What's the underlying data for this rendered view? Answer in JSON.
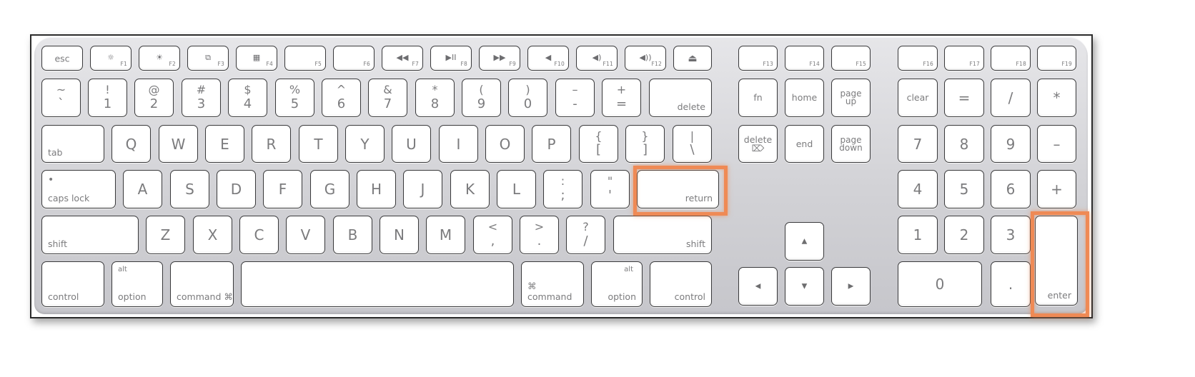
{
  "keyboard": {
    "highlight_color": "#ef8a55",
    "highlighted_keys": [
      "return",
      "enter"
    ],
    "function_row": [
      {
        "id": "esc",
        "label": "esc"
      },
      {
        "id": "f1",
        "icon": "brightness-down-icon",
        "glyph": "☼",
        "num": "F1"
      },
      {
        "id": "f2",
        "icon": "brightness-up-icon",
        "glyph": "☀",
        "num": "F2"
      },
      {
        "id": "f3",
        "icon": "expose-icon",
        "glyph": "⧉",
        "num": "F3"
      },
      {
        "id": "f4",
        "icon": "dashboard-icon",
        "glyph": "▦",
        "num": "F4"
      },
      {
        "id": "f5",
        "num": "F5"
      },
      {
        "id": "f6",
        "num": "F6"
      },
      {
        "id": "f7",
        "icon": "rewind-icon",
        "glyph": "◀◀",
        "num": "F7"
      },
      {
        "id": "f8",
        "icon": "play-pause-icon",
        "glyph": "▶II",
        "num": "F8"
      },
      {
        "id": "f9",
        "icon": "fast-forward-icon",
        "glyph": "▶▶",
        "num": "F9"
      },
      {
        "id": "f10",
        "icon": "mute-icon",
        "glyph": "◀",
        "num": "F10"
      },
      {
        "id": "f11",
        "icon": "volume-down-icon",
        "glyph": "◀)",
        "num": "F11"
      },
      {
        "id": "f12",
        "icon": "volume-up-icon",
        "glyph": "◀))",
        "num": "F12"
      },
      {
        "id": "eject",
        "icon": "eject-icon",
        "glyph": "⏏"
      },
      {
        "id": "f13",
        "num": "F13"
      },
      {
        "id": "f14",
        "num": "F14"
      },
      {
        "id": "f15",
        "num": "F15"
      },
      {
        "id": "f16",
        "num": "F16"
      },
      {
        "id": "f17",
        "num": "F17"
      },
      {
        "id": "f18",
        "num": "F18"
      },
      {
        "id": "f19",
        "num": "F19"
      }
    ],
    "number_row": [
      {
        "id": "backtick",
        "shift": "~",
        "base": "`"
      },
      {
        "id": "1",
        "shift": "!",
        "base": "1"
      },
      {
        "id": "2",
        "shift": "@",
        "base": "2"
      },
      {
        "id": "3",
        "shift": "#",
        "base": "3"
      },
      {
        "id": "4",
        "shift": "$",
        "base": "4"
      },
      {
        "id": "5",
        "shift": "%",
        "base": "5"
      },
      {
        "id": "6",
        "shift": "^",
        "base": "6"
      },
      {
        "id": "7",
        "shift": "&",
        "base": "7"
      },
      {
        "id": "8",
        "shift": "*",
        "base": "8"
      },
      {
        "id": "9",
        "shift": "(",
        "base": "9"
      },
      {
        "id": "0",
        "shift": ")",
        "base": "0"
      },
      {
        "id": "minus",
        "shift": "–",
        "base": "-"
      },
      {
        "id": "equals",
        "shift": "+",
        "base": "="
      },
      {
        "id": "delete",
        "label": "delete"
      },
      {
        "id": "fn",
        "label": "fn"
      },
      {
        "id": "home",
        "label": "home"
      },
      {
        "id": "page-up",
        "label": "page\nup"
      },
      {
        "id": "clear",
        "label": "clear"
      },
      {
        "id": "kp-equals",
        "label": "="
      },
      {
        "id": "kp-divide",
        "label": "/"
      },
      {
        "id": "kp-multiply",
        "label": "*"
      }
    ],
    "top_row": [
      {
        "id": "tab",
        "label": "tab"
      },
      {
        "id": "q",
        "label": "Q"
      },
      {
        "id": "w",
        "label": "W"
      },
      {
        "id": "e",
        "label": "E"
      },
      {
        "id": "r",
        "label": "R"
      },
      {
        "id": "t",
        "label": "T"
      },
      {
        "id": "y",
        "label": "Y"
      },
      {
        "id": "u",
        "label": "U"
      },
      {
        "id": "i",
        "label": "I"
      },
      {
        "id": "o",
        "label": "O"
      },
      {
        "id": "p",
        "label": "P"
      },
      {
        "id": "lbracket",
        "shift": "{",
        "base": "["
      },
      {
        "id": "rbracket",
        "shift": "}",
        "base": "]"
      },
      {
        "id": "backslash",
        "shift": "|",
        "base": "\\"
      },
      {
        "id": "forward-delete",
        "label": "delete ⌦"
      },
      {
        "id": "end",
        "label": "end"
      },
      {
        "id": "page-down",
        "label": "page\ndown"
      },
      {
        "id": "kp-7",
        "label": "7"
      },
      {
        "id": "kp-8",
        "label": "8"
      },
      {
        "id": "kp-9",
        "label": "9"
      },
      {
        "id": "kp-minus",
        "label": "–"
      }
    ],
    "home_row": [
      {
        "id": "caps-lock",
        "label": "caps lock",
        "indicator": "•"
      },
      {
        "id": "a",
        "label": "A"
      },
      {
        "id": "s",
        "label": "S"
      },
      {
        "id": "d",
        "label": "D"
      },
      {
        "id": "f",
        "label": "F"
      },
      {
        "id": "g",
        "label": "G"
      },
      {
        "id": "h",
        "label": "H"
      },
      {
        "id": "j",
        "label": "J"
      },
      {
        "id": "k",
        "label": "K"
      },
      {
        "id": "l",
        "label": "L"
      },
      {
        "id": "semicolon",
        "shift": ":",
        "base": ";"
      },
      {
        "id": "quote",
        "shift": "\"",
        "base": "'"
      },
      {
        "id": "return",
        "label": "return"
      },
      {
        "id": "kp-4",
        "label": "4"
      },
      {
        "id": "kp-5",
        "label": "5"
      },
      {
        "id": "kp-6",
        "label": "6"
      },
      {
        "id": "kp-plus",
        "label": "+"
      }
    ],
    "bottom_row": [
      {
        "id": "left-shift",
        "label": "shift"
      },
      {
        "id": "z",
        "label": "Z"
      },
      {
        "id": "x",
        "label": "X"
      },
      {
        "id": "c",
        "label": "C"
      },
      {
        "id": "v",
        "label": "V"
      },
      {
        "id": "b",
        "label": "B"
      },
      {
        "id": "n",
        "label": "N"
      },
      {
        "id": "m",
        "label": "M"
      },
      {
        "id": "comma",
        "shift": "<",
        "base": ","
      },
      {
        "id": "period",
        "shift": ">",
        "base": "."
      },
      {
        "id": "slash",
        "shift": "?",
        "base": "/"
      },
      {
        "id": "right-shift",
        "label": "shift"
      },
      {
        "id": "up",
        "icon": "arrow-up-icon",
        "glyph": "▲"
      },
      {
        "id": "kp-1",
        "label": "1"
      },
      {
        "id": "kp-2",
        "label": "2"
      },
      {
        "id": "kp-3",
        "label": "3"
      },
      {
        "id": "enter",
        "label": "enter"
      }
    ],
    "space_row": [
      {
        "id": "left-control",
        "label": "control"
      },
      {
        "id": "left-option",
        "label": "option",
        "alt": "alt"
      },
      {
        "id": "left-command",
        "label": "command ⌘"
      },
      {
        "id": "space",
        "label": ""
      },
      {
        "id": "right-command",
        "label": "⌘ command"
      },
      {
        "id": "right-option",
        "label": "option",
        "alt": "alt"
      },
      {
        "id": "right-control",
        "label": "control"
      },
      {
        "id": "left",
        "icon": "arrow-left-icon",
        "glyph": "◀"
      },
      {
        "id": "down",
        "icon": "arrow-down-icon",
        "glyph": "▼"
      },
      {
        "id": "right",
        "icon": "arrow-right-icon",
        "glyph": "▶"
      },
      {
        "id": "kp-0",
        "label": "0"
      },
      {
        "id": "kp-decimal",
        "label": "."
      }
    ]
  }
}
